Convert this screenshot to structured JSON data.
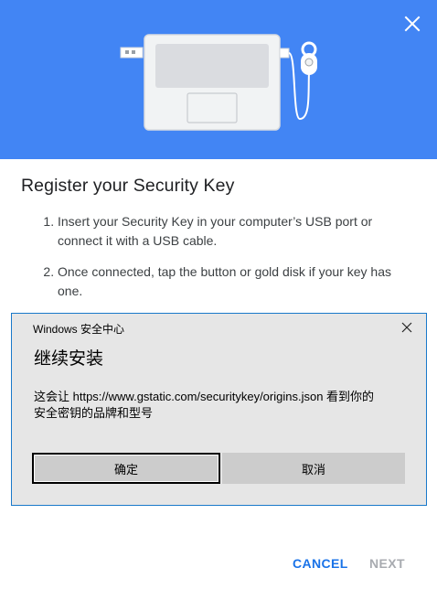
{
  "colors": {
    "hero_background": "#4285f4",
    "primary_action": "#1a73e8",
    "disabled_action": "#a8abb0",
    "dialog_border": "#1979ca"
  },
  "header": {
    "illustration": "laptop-with-security-key-icon",
    "close_icon": "close-icon"
  },
  "main": {
    "title": "Register your Security Key",
    "steps": [
      "Insert your Security Key in your computer’s USB port or connect it with a USB cable.",
      "Once connected, tap the button or gold disk if your key has one."
    ]
  },
  "windows_dialog": {
    "caption": "Windows 安全中心",
    "heading": "继续安装",
    "message_line1": "这会让 https://www.gstatic.com/securitykey/origins.json 看到你的",
    "message_line2": "安全密钥的品牌和型号",
    "ok_label": "确定",
    "cancel_label": "取消"
  },
  "footer": {
    "cancel_label": "CANCEL",
    "next_label": "NEXT"
  }
}
